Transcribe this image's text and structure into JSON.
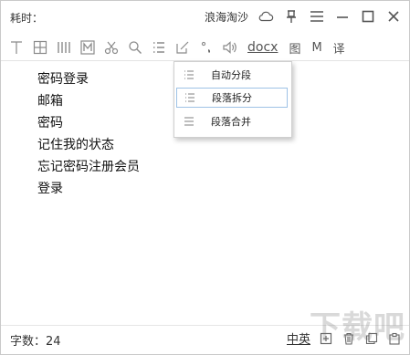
{
  "titlebar": {
    "elapsed_label": "耗时：",
    "username": "浪海淘沙"
  },
  "toolbar": {
    "docx_label": "docx",
    "image_label": "图",
    "m_label": "M",
    "translate_label": "译"
  },
  "document": {
    "lines": [
      "密码登录",
      "邮箱",
      "密码",
      "记住我的状态",
      "忘记密码注册会员",
      "登录"
    ]
  },
  "paragraph_menu": {
    "items": [
      {
        "label": "自动分段"
      },
      {
        "label": "段落拆分"
      },
      {
        "label": "段落合并"
      }
    ]
  },
  "statusbar": {
    "char_count": "字数：24",
    "lang_toggle": "中英"
  },
  "watermark": {
    "text": "下载吧"
  },
  "colors": {
    "accent": "#9ec2e6",
    "icon_gray": "#7a7a7a"
  }
}
